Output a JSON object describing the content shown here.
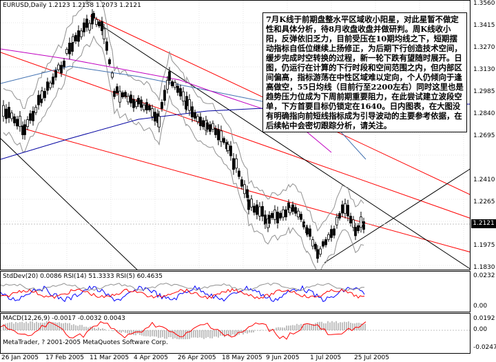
{
  "main_pane": {
    "title": "EURUSD,Daily  1.2123 1.2158 1.2073 1.2121",
    "price_axis": [
      "1.3560",
      "1.3415",
      "1.3270",
      "1.3130",
      "1.2985",
      "1.2840",
      "1.2695",
      "1.2410",
      "1.2265",
      "1.2121",
      "1.1975",
      "1.1830"
    ],
    "current_price": "1.2121",
    "note": "7月K线于前期盘整水平区域收小阳星，对此星暂不做定性和具体分析，待8月收盘收盘并做研判。周K线收小阳，反弹依旧乏力，目前受压在10期均线之下，短期摆动指标自低位继续上扬修正，为后期下行创造技术空间，缓步完成时空转换的过程，新一轮下跌有望随时展开。日图，仍运行在计算的下行时段和空间范围之内，但内部区间偏高，指标游荡在中性区域难以定向，个人仍倾向于逢高做空，55日均线（目前行至2200左右）同时这里也是趋势压力位成为下周前期重要阻力，在此尝试建立波段空单，下方首要目标仍锁定在1640。日内图表，在大图没有明确指向前短线指标成为引导波动的主要参考依据，在后续帖中会密切跟踪分析，请关注。"
  },
  "indicator_pane_1": {
    "title": "StdDev(20) 0.0086  RSI(14) 51.3333  RSI(5) 60.4635",
    "axis": [
      "0.0232",
      "0.00"
    ]
  },
  "indicator_pane_2": {
    "title": "MACD(12,26,9) -0.0017 -0.0032 0.0043",
    "axis": [
      "0.0192",
      "0.00",
      "-0.0247"
    ],
    "copyright": "MetaTrader, ? 2001-2005 MetaQuotes Software Corp."
  },
  "date_axis": [
    "26 Jan 2005",
    "17 Feb 2005",
    "11 Mar 2005",
    "4 Apr 2005",
    "26 Apr 2005",
    "18 May 2005",
    "9 Jun 2005",
    "1 Jul 2005",
    "25 Jul 2005"
  ],
  "colors": {
    "candles": "#000000",
    "channel_red": "#ff0000",
    "channel_black": "#000000",
    "ma_blue": "#0000a0",
    "ma_magenta": "#c000c0",
    "ma_steel": "#4070b0",
    "bands_gray": "#909090",
    "current_price_bg": "#000000"
  }
}
